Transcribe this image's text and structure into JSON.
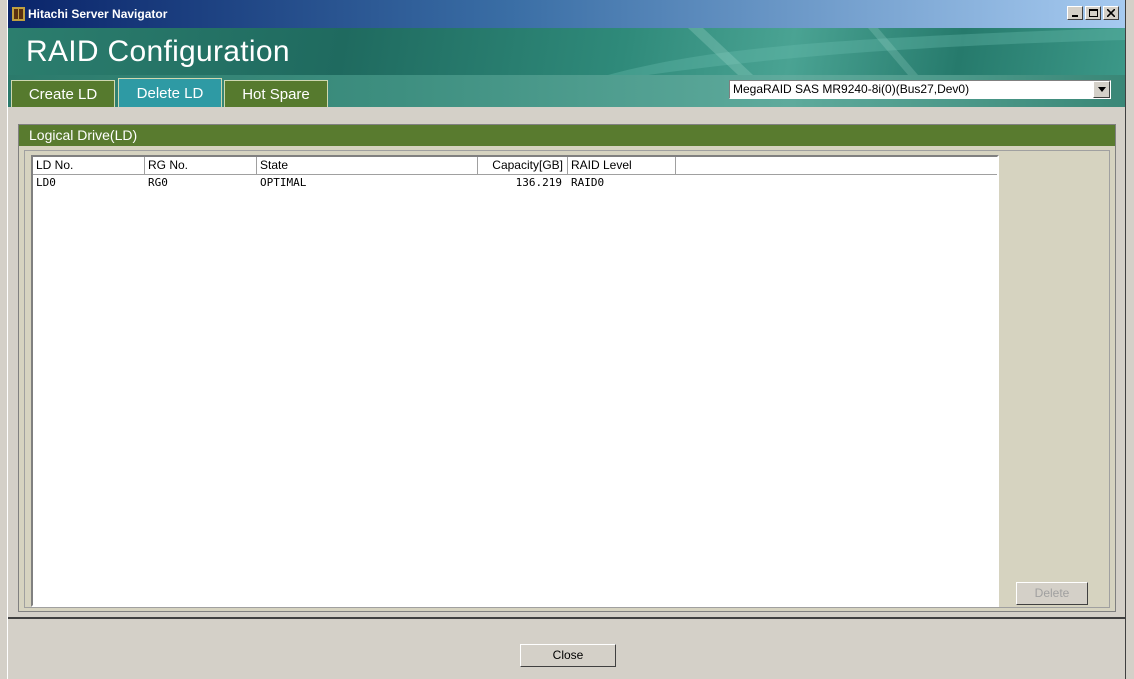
{
  "window": {
    "title": "Hitachi Server Navigator"
  },
  "banner": {
    "title": "RAID Configuration"
  },
  "tabs": [
    {
      "label": "Create LD"
    },
    {
      "label": "Delete LD"
    },
    {
      "label": "Hot Spare"
    }
  ],
  "controller_select": {
    "value": "MegaRAID SAS MR9240-8i(0)(Bus27,Dev0)"
  },
  "group": {
    "title": "Logical Drive(LD)"
  },
  "list": {
    "columns": [
      "LD No.",
      "RG No.",
      "State",
      "Capacity[GB]",
      "RAID Level"
    ],
    "rows": [
      [
        "LD0",
        "RG0",
        "OPTIMAL",
        "136.219",
        "RAID0"
      ]
    ]
  },
  "buttons": {
    "delete": "Delete",
    "close": "Close"
  },
  "colors": {
    "tab_active": "#2e9aa4",
    "tab_inactive": "#567a2e",
    "group_bar": "#597b2f",
    "banner": "#2c7e6e"
  }
}
